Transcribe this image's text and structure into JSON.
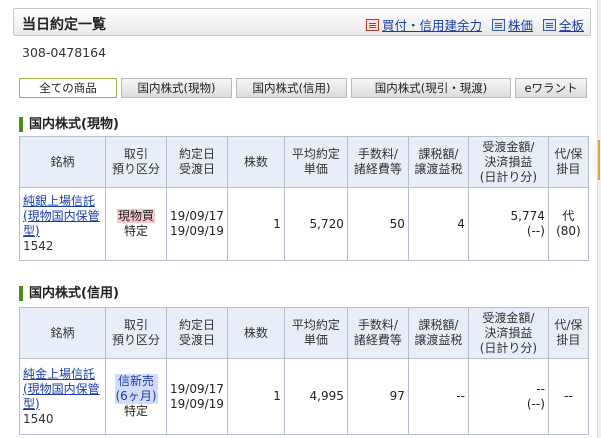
{
  "header": {
    "title": "当日約定一覧",
    "links": [
      {
        "label": "買付・信用建余力",
        "icon": "report-icon"
      },
      {
        "label": "株価",
        "icon": "list-icon"
      },
      {
        "label": "全板",
        "icon": "board-icon"
      }
    ]
  },
  "account": "308-0478164",
  "tabs": [
    "全ての商品",
    "国内株式(現物)",
    "国内株式(信用)",
    "国内株式(現引・現渡)",
    "eワラント"
  ],
  "active_tab": "全ての商品",
  "columns": [
    "銘柄",
    "取引\n預り区分",
    "約定日\n受渡日",
    "株数",
    "平均約定\n単価",
    "手数料/\n諸経費等",
    "課税額/\n譲渡益税",
    "受渡金額/\n決済損益\n(日計り分)",
    "代/保\n掛目"
  ],
  "sections": [
    {
      "title": "国内株式(現物)",
      "rows": [
        {
          "name": "純銀上場信託(現物国内保管型)",
          "code": "1542",
          "trade_type": "現物買",
          "custody": "特定",
          "trade_date": "19/09/17",
          "settle_date": "19/09/19",
          "shares": "1",
          "price": "5,720",
          "fee": "50",
          "tax": "4",
          "amount": "5,774",
          "pnl": "(--)",
          "margin_type": "代",
          "margin_rate": "(80)"
        }
      ]
    },
    {
      "title": "国内株式(信用)",
      "rows": [
        {
          "name": "純金上場信託(現物国内保管型)",
          "code": "1540",
          "trade_type": "信新売\n(6ヶ月)",
          "custody": "特定",
          "trade_date": "19/09/17",
          "settle_date": "19/09/19",
          "shares": "1",
          "price": "4,995",
          "fee": "97",
          "tax": "--",
          "amount": "--",
          "pnl": "(--)",
          "margin_type": "--",
          "margin_rate": ""
        }
      ]
    }
  ]
}
